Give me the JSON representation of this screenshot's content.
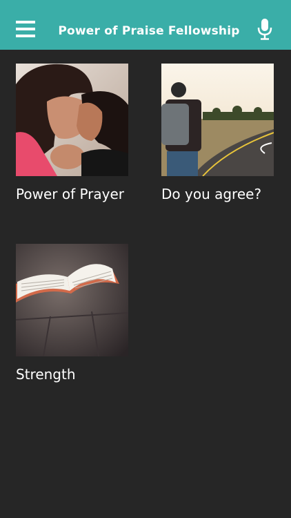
{
  "header": {
    "title": "Power of Praise Fellowship",
    "menu_icon": "hamburger-menu-icon",
    "mic_icon": "microphone-icon",
    "background": "#3aaea8"
  },
  "cards": [
    {
      "label": "Power of Prayer",
      "image": "mother-daughter-praying-photo"
    },
    {
      "label": "Do you agree?",
      "image": "man-backpack-road-photo"
    },
    {
      "label": "Strength",
      "image": "open-bible-photo"
    }
  ],
  "colors": {
    "page_background": "#262626",
    "text": "#ffffff"
  }
}
